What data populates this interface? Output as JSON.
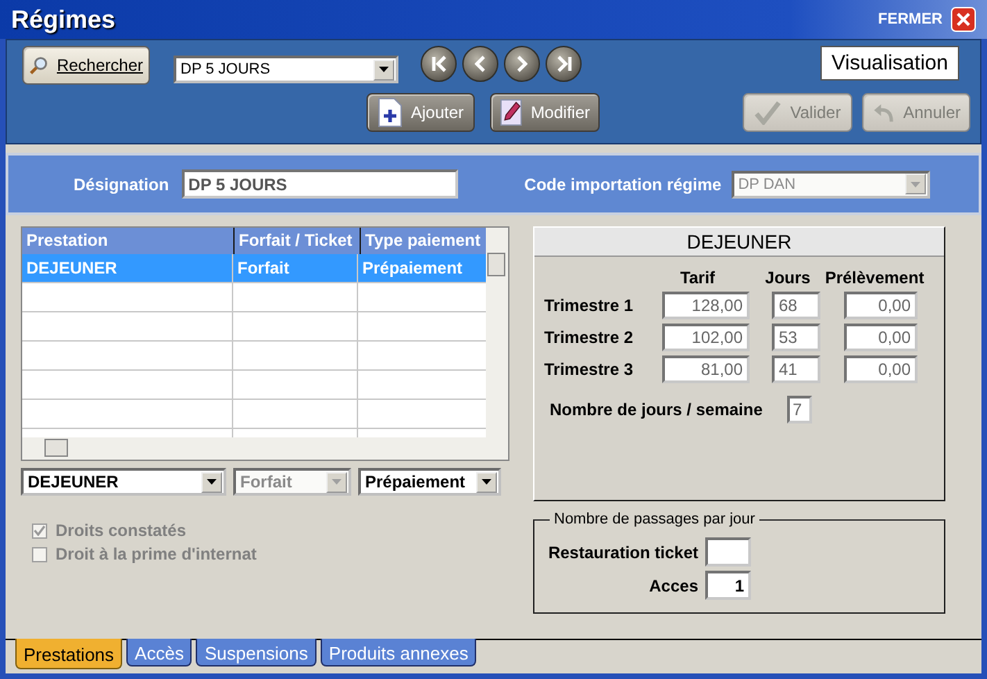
{
  "window": {
    "title": "Régimes",
    "close_label": "FERMER"
  },
  "toolbar": {
    "search_button": "Rechercher",
    "record_select": "DP 5 JOURS",
    "nav_buttons": [
      {
        "kind": "first"
      },
      {
        "kind": "previous"
      },
      {
        "kind": "next"
      },
      {
        "kind": "last"
      }
    ],
    "add_button": "Ajouter",
    "edit_button": "Modifier",
    "mode": "Visualisation",
    "validate_button": {
      "label": "Valider",
      "disabled": true
    },
    "cancel_button": {
      "label": "Annuler",
      "disabled": true
    }
  },
  "header": {
    "designation_label": "Désignation",
    "designation": "DP 5 JOURS",
    "import_code_label": "Code importation régime",
    "import_code": {
      "value": "DP DAN",
      "disabled": true
    }
  },
  "table": {
    "columns": [
      "Prestation",
      "Forfait / Ticket",
      "Type paiement"
    ],
    "rows": [
      {
        "cells": [
          "DEJEUNER",
          "Forfait",
          "Prépaiement"
        ],
        "selected": true
      }
    ]
  },
  "row_editors": [
    {
      "value": "DEJEUNER",
      "disabled": false
    },
    {
      "value": "Forfait",
      "disabled": true
    },
    {
      "value": "Prépaiement",
      "disabled": false
    }
  ],
  "checkboxes": [
    {
      "label": "Droits constatés",
      "checked": true,
      "disabled": true
    },
    {
      "label": "Droit à la prime d'internat",
      "checked": false,
      "disabled": true
    }
  ],
  "detail": {
    "title": "DEJEUNER",
    "columns": [
      "Tarif",
      "Jours",
      "Prélèvement"
    ],
    "rows": [
      {
        "label": "Trimestre 1",
        "values": [
          "128,00",
          "68",
          "0,00"
        ]
      },
      {
        "label": "Trimestre 2",
        "values": [
          "102,00",
          "53",
          "0,00"
        ]
      },
      {
        "label": "Trimestre 3",
        "values": [
          "81,00",
          "41",
          "0,00"
        ]
      }
    ],
    "days_per_week_label": "Nombre de jours / semaine",
    "days_per_week": "7"
  },
  "passages": {
    "legend": "Nombre de passages par jour",
    "fields": [
      {
        "label": "Restauration ticket"
      },
      {
        "label": "Acces",
        "value": "1"
      }
    ]
  },
  "tabs": [
    {
      "label": "Prestations",
      "selected": true
    },
    {
      "label": "Accès",
      "selected": false
    },
    {
      "label": "Suspensions",
      "selected": false
    },
    {
      "label": "Produits annexes",
      "selected": false
    }
  ]
}
